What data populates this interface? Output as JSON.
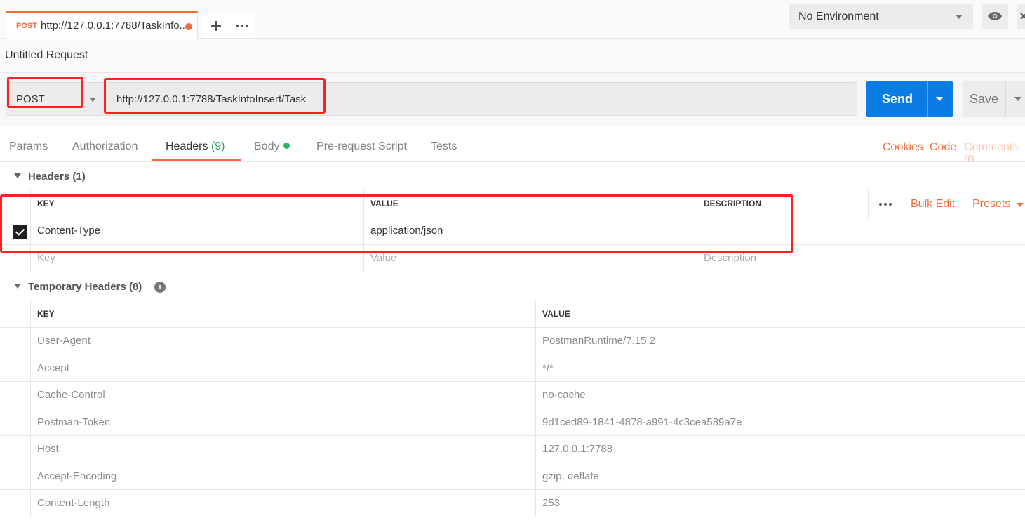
{
  "tab": {
    "method": "POST",
    "url": "http://127.0.0.1:7788/TaskInfo...",
    "add_icon": "plus-icon",
    "more_icon": "ellipsis-icon"
  },
  "environment": {
    "selected": "No Environment",
    "eye_icon": "eye-icon",
    "close_icon": "close-icon"
  },
  "request": {
    "name": "Untitled Request",
    "method": "POST",
    "url": "http://127.0.0.1:7788/TaskInfoInsert/Task",
    "send_label": "Send",
    "save_label": "Save"
  },
  "request_tabs": {
    "params": "Params",
    "authorization": "Authorization",
    "headers": "Headers",
    "headers_count": "(9)",
    "body": "Body",
    "prerequest": "Pre-request Script",
    "tests": "Tests"
  },
  "right_links": {
    "cookies": "Cookies",
    "code": "Code",
    "comments": "Comments (0"
  },
  "headers_section": {
    "title": "Headers (1)",
    "columns": {
      "key": "KEY",
      "value": "VALUE",
      "description": "DESCRIPTION"
    },
    "bulk_edit": "Bulk Edit",
    "presets": "Presets",
    "rows": [
      {
        "key": "Content-Type",
        "value": "application/json",
        "description": "",
        "checked": true
      }
    ],
    "placeholders": {
      "key": "Key",
      "value": "Value",
      "description": "Description"
    }
  },
  "temp_headers_section": {
    "title": "Temporary Headers (8)",
    "info_icon": "info-icon",
    "columns": {
      "key": "KEY",
      "value": "VALUE"
    },
    "rows": [
      {
        "key": "User-Agent",
        "value": "PostmanRuntime/7.15.2"
      },
      {
        "key": "Accept",
        "value": "*/*"
      },
      {
        "key": "Cache-Control",
        "value": "no-cache"
      },
      {
        "key": "Postman-Token",
        "value": "9d1ced89-1841-4878-a991-4c3cea589a7e"
      },
      {
        "key": "Host",
        "value": "127.0.0.1:7788"
      },
      {
        "key": "Accept-Encoding",
        "value": "gzip, deflate"
      },
      {
        "key": "Content-Length",
        "value": "253"
      }
    ]
  },
  "colors": {
    "accent": "#f26b3a",
    "send": "#0b7ce4",
    "highlight": "#ff2020",
    "success": "#2aa36b"
  }
}
